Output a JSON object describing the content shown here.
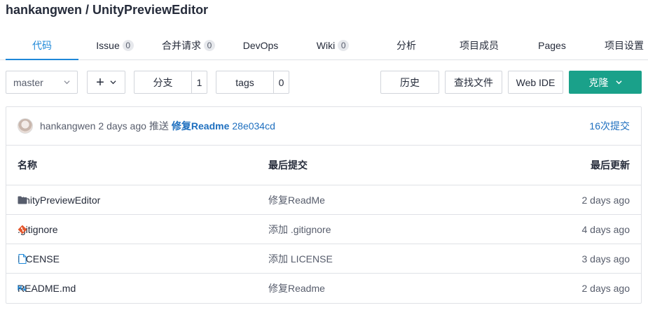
{
  "repo": {
    "title": "hankangwen / UnityPreviewEditor"
  },
  "tabs": [
    {
      "label": "代码",
      "count": null,
      "active": true
    },
    {
      "label": "Issue",
      "count": "0"
    },
    {
      "label": "合并请求",
      "count": "0"
    },
    {
      "label": "DevOps",
      "count": null
    },
    {
      "label": "Wiki",
      "count": "0"
    },
    {
      "label": "分析",
      "count": null
    },
    {
      "label": "项目成员",
      "count": null
    },
    {
      "label": "Pages",
      "count": null
    },
    {
      "label": "项目设置",
      "count": null
    }
  ],
  "toolbar": {
    "branch_select": "master",
    "add_label": "+",
    "branches_label": "分支",
    "branches_count": "1",
    "tags_label": "tags",
    "tags_count": "0",
    "history_label": "历史",
    "find_file_label": "查找文件",
    "web_ide_label": "Web IDE",
    "clone_label": "克隆"
  },
  "last_commit": {
    "author": "hankangwen",
    "time": "2 days ago",
    "action": "推送",
    "message": "修复Readme",
    "hash": "28e034cd",
    "commit_count": "16次提交"
  },
  "table": {
    "headers": {
      "name": "名称",
      "last_commit": "最后提交",
      "last_update": "最后更新"
    },
    "rows": [
      {
        "icon": "folder-icon",
        "name": "UnityPreviewEditor",
        "commit": "修复ReadMe",
        "date": "2 days ago"
      },
      {
        "icon": "git-icon",
        "name": ".gitignore",
        "commit": "添加 .gitignore",
        "date": "4 days ago"
      },
      {
        "icon": "file-icon",
        "name": "LICENSE",
        "commit": "添加 LICENSE",
        "date": "3 days ago"
      },
      {
        "icon": "markdown-icon",
        "name": "README.md",
        "commit": "修复Readme",
        "date": "2 days ago"
      }
    ]
  },
  "colors": {
    "accent": "#1e88d8",
    "primary_button": "#1aa18a",
    "link": "#1e6fbf",
    "git_icon": "#e4572e"
  }
}
